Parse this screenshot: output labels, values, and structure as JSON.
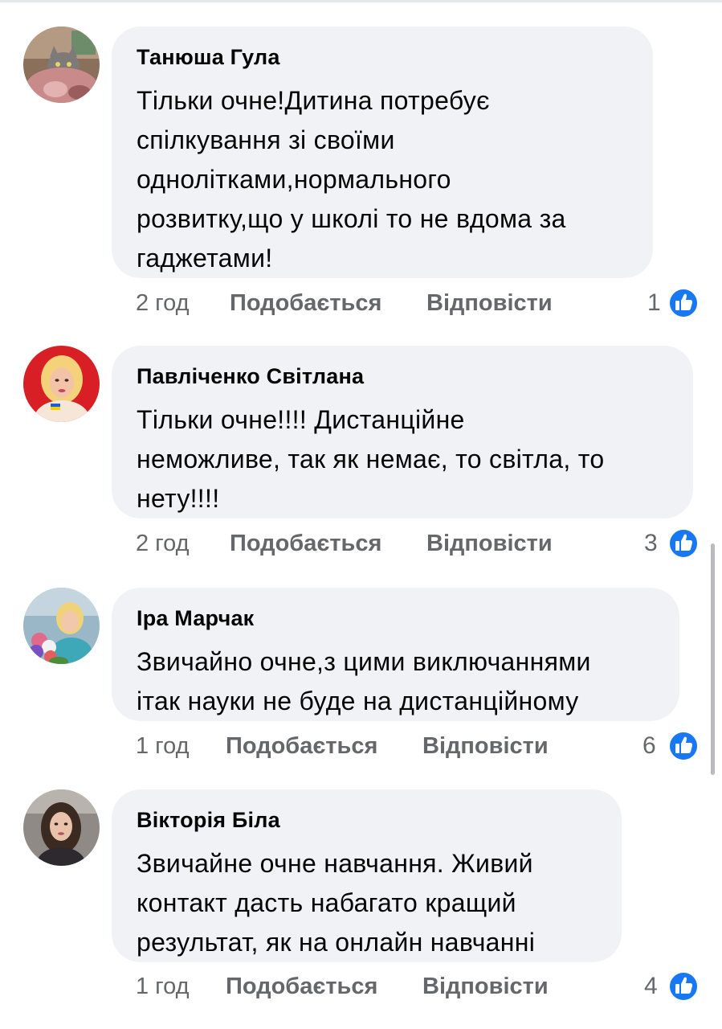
{
  "comments": [
    {
      "author": "Танюша Гула",
      "text": "Тільки очне!Дитина потребує\nспілкування зі своїми\nоднолітками,нормального\nрозвитку,що у школі то не вдома за\nгаджетами!",
      "time": "2 год",
      "like_label": "Подобається",
      "reply_label": "Відповісти",
      "reactions": "1"
    },
    {
      "author": "Павліченко Світлана",
      "text": "Тільки  очне!!!! Дистанційне\nнеможливе, так як немає, то світла, то\nнету!!!!",
      "time": "2 год",
      "like_label": "Подобається",
      "reply_label": "Відповісти",
      "reactions": "3"
    },
    {
      "author": "Іра Марчак",
      "text": "Звичайно очне,з цими виключаннями\nітак науки не буде на дистанційному",
      "time": "1 год",
      "like_label": "Подобається",
      "reply_label": "Відповісти",
      "reactions": "6"
    },
    {
      "author": "Вікторія Біла",
      "text": "Звичайне очне навчання. Живий\nконтакт дасть набагато кращий\nрезультат, як  на онлайн навчанні",
      "time": "1 год",
      "like_label": "Подобається",
      "reply_label": "Відповісти",
      "reactions": "4"
    }
  ],
  "icons": {
    "reaction": "like-thumb-icon"
  },
  "colors": {
    "bubble": "#f0f2f5",
    "meta_text": "#65676b",
    "like_blue": "#1877f2"
  }
}
